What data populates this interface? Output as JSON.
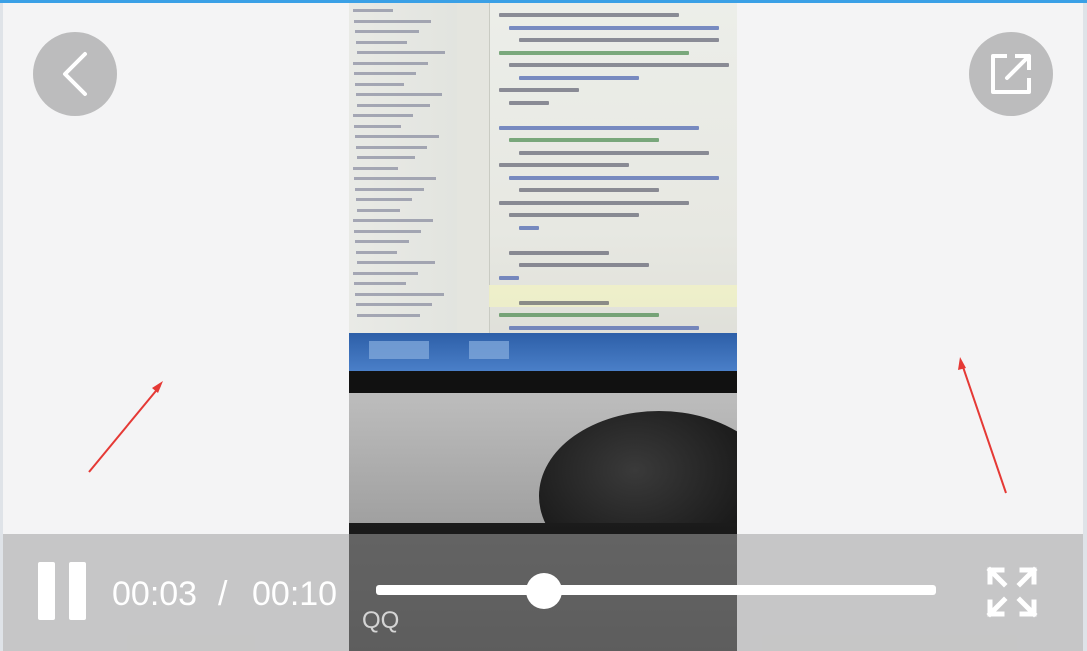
{
  "player": {
    "current_time": "00:03",
    "separator": "/",
    "duration": "00:10",
    "progress": 0.3
  },
  "controls": {
    "back_icon": "chevron-left-icon",
    "share_icon": "share-external-icon",
    "pause_icon": "pause-icon",
    "fullscreen_icon": "fullscreen-icon"
  },
  "watermark": {
    "text": "QQ"
  },
  "colors": {
    "accent_top_rule": "#3aa0e6",
    "annotation_arrow": "#e53935"
  }
}
